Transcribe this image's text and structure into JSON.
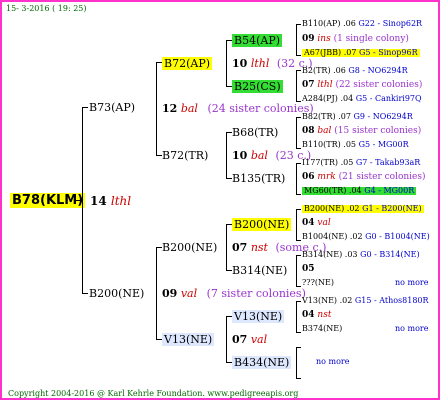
{
  "header": {
    "date": "15-  3-2016 ( 19: 25)"
  },
  "root": {
    "name": "B78(KLM)",
    "year": "14",
    "breeder": "lthl"
  },
  "gen1": [
    {
      "name": "B73(AP)",
      "year": "12",
      "breeder": "bal",
      "sisters": "(24 sister colonies)"
    },
    {
      "name": "B200(NE)",
      "year": "09",
      "breeder": "val",
      "sisters": "(7 sister colonies)"
    }
  ],
  "gen2": [
    {
      "name": "B72(AP)",
      "year": "10",
      "breeder": "lthl",
      "sisters": "(32 c.)"
    },
    {
      "name": "B72(TR)",
      "year": "10",
      "breeder": "bal",
      "sisters": "(23 c.)"
    },
    {
      "name": "B200(NE)",
      "year": "07",
      "breeder": "nst",
      "sisters": "(some c.)"
    },
    {
      "name": "V13(NE)",
      "year": "07",
      "breeder": "val"
    }
  ],
  "gen3": [
    {
      "name": "B54(AP)",
      "year": "09",
      "breeder": "ins",
      "sisters": "(1 single colony)"
    },
    {
      "name": "B25(CS)",
      "year": "07",
      "breeder": "lthl",
      "sisters": "(22 sister colonies)"
    },
    {
      "name": "B68(TR)",
      "year": "08",
      "breeder": "bal",
      "sisters": "(15 sister colonies)"
    },
    {
      "name": "B135(TR)",
      "year": "06",
      "breeder": "mrk",
      "sisters": "(21 sister colonies)"
    },
    {
      "name": "B200(NE)",
      "year": "04",
      "breeder": "val"
    },
    {
      "name": "B314(NE)",
      "year": "05"
    },
    {
      "name": "V13(NE)",
      "year": "04",
      "breeder": "nst"
    },
    {
      "name": "B434(NE)"
    }
  ],
  "gen4": [
    {
      "name": "B110(AP)",
      "year": ".06",
      "origin": "G22 - Sinop62R"
    },
    {
      "name": "A67(JBB)",
      "year": ".07",
      "origin": "G5 - Sinop96R"
    },
    {
      "name": "B2(TR)",
      "year": ".06",
      "origin": "G8 - NO6294R"
    },
    {
      "name": "A284(PJ)",
      "year": ".04",
      "origin": "G5 - Cankiri97Q"
    },
    {
      "name": "B82(TR)",
      "year": ".07",
      "origin": "G9 - NO6294R"
    },
    {
      "name": "B110(TR)",
      "year": ".05",
      "origin": "G5 - MG00R"
    },
    {
      "name": "I177(TR)",
      "year": ".05",
      "origin": "G7 - Takab93aR"
    },
    {
      "name": "MG60(TR)",
      "year": ".04",
      "origin": "G4 - MG00R"
    },
    {
      "name": "B200(NE)",
      "year": ".02",
      "origin": "G1 - B200(NE)"
    },
    {
      "name": "B1004(NE)",
      "year": ".02",
      "origin": "G0 - B1004(NE)"
    },
    {
      "name": "B314(NE)",
      "year": ".03",
      "origin": "G0 - B314(NE)"
    },
    {
      "name": "???(NE)",
      "more": "no more"
    },
    {
      "name": "V13(NE)",
      "year": ".02",
      "origin": "G15 - Athos8180R"
    },
    {
      "name": "B374(NE)",
      "more": "no more"
    },
    {
      "more": "no more"
    }
  ],
  "footer": {
    "copyright": "Copyright 2004-2016 @ Karl Kehrle Foundation.   www.pedigreeapis.org"
  }
}
